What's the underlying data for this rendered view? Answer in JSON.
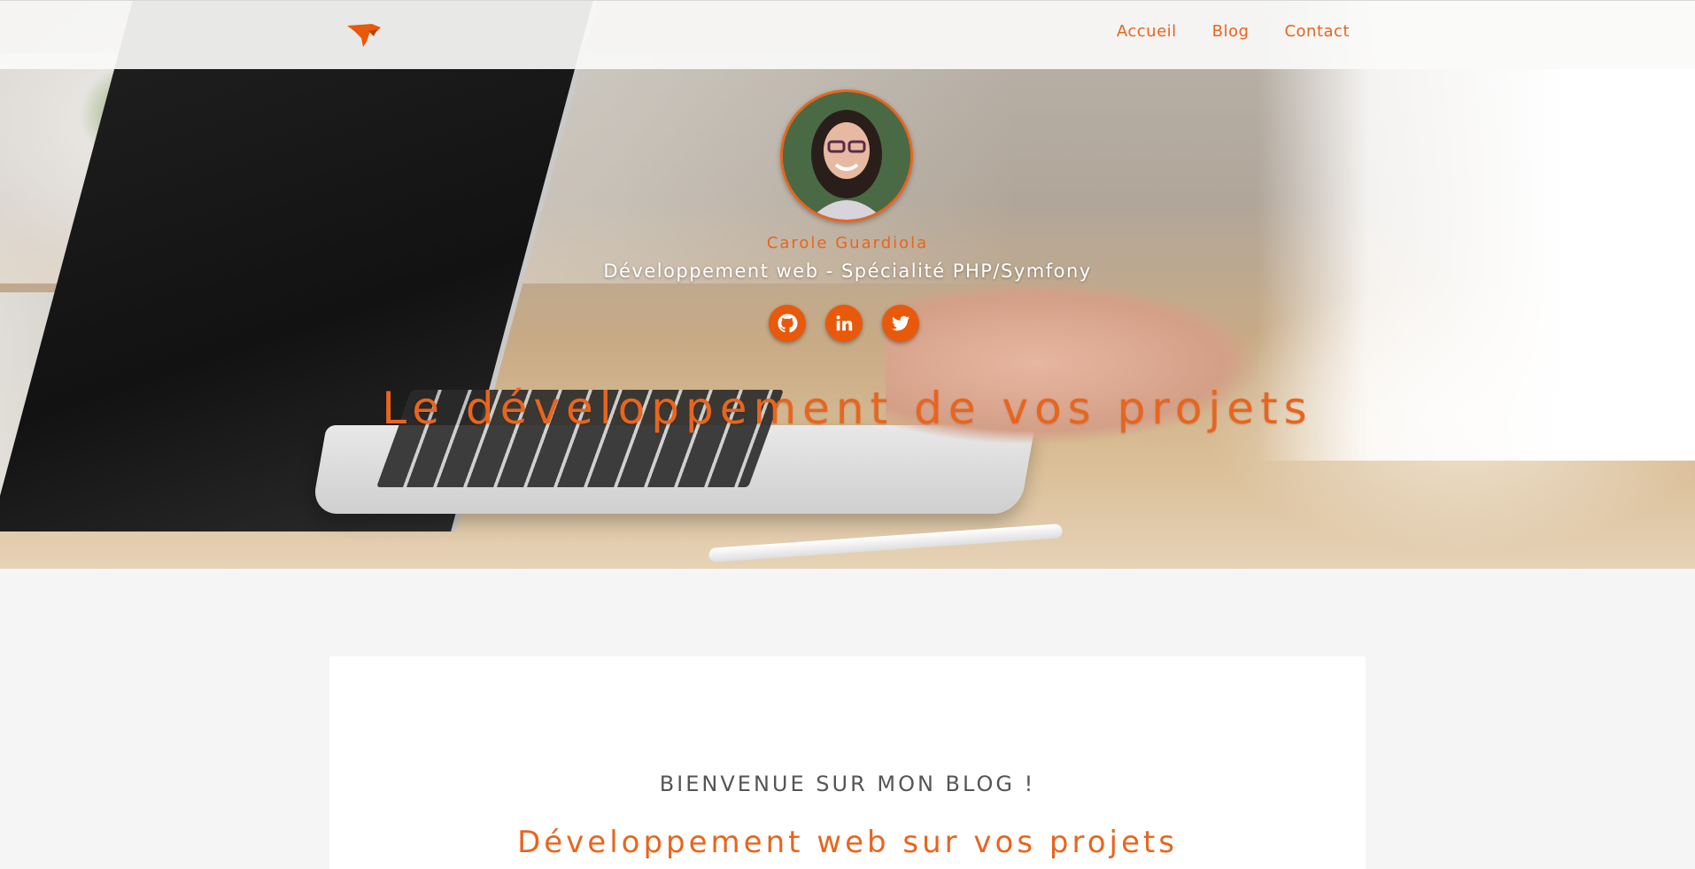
{
  "nav": {
    "links": [
      "Accueil",
      "Blog",
      "Contact"
    ]
  },
  "hero": {
    "author_name": "Carole Guardiola",
    "tagline": "Développement web - Spécialité PHP/Symfony",
    "title": "Le développement de vos projets",
    "socials": [
      "github-icon",
      "linkedin-icon",
      "twitter-icon"
    ]
  },
  "content": {
    "welcome": "BIENVENUE SUR MON BLOG !",
    "subtitle": "Développement web sur vos projets"
  },
  "colors": {
    "accent": "#e8651e",
    "background": "#f5f5f5",
    "card": "#ffffff"
  }
}
